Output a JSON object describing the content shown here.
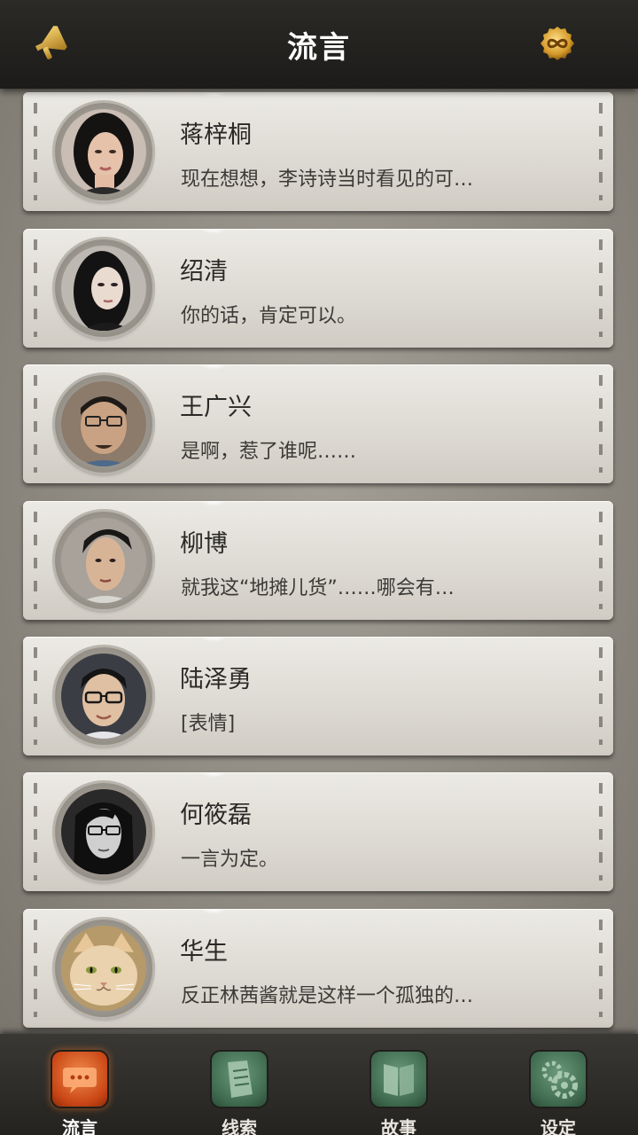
{
  "header": {
    "title": "流言",
    "left_icon": "megaphone-icon",
    "right_icon": "infinity-coin-icon",
    "accent_color": "#d9a531"
  },
  "messages": [
    {
      "name": "蒋梓桐",
      "preview": "现在想想，李诗诗当时看见的可…",
      "avatar": "woman-portrait-avatar"
    },
    {
      "name": "绍清",
      "preview": "你的话，肯定可以。",
      "avatar": "woman-portrait-avatar"
    },
    {
      "name": "王广兴",
      "preview": "是啊，惹了谁呢……",
      "avatar": "man-glasses-portrait-avatar"
    },
    {
      "name": "柳博",
      "preview": "就我这“地摊儿货”……哪会有…",
      "avatar": "man-portrait-avatar"
    },
    {
      "name": "陆泽勇",
      "preview": "[表情]",
      "avatar": "man-glasses-portrait-avatar"
    },
    {
      "name": "何筱磊",
      "preview": "一言为定。",
      "avatar": "man-glasses-portrait-avatar"
    },
    {
      "name": "华生",
      "preview": "反正林茜酱就是这样一个孤独的…",
      "avatar": "cat-portrait-avatar"
    }
  ],
  "tabs": [
    {
      "label": "流言",
      "icon": "chat-bubble-icon",
      "active": true
    },
    {
      "label": "线索",
      "icon": "note-paper-icon",
      "active": false
    },
    {
      "label": "故事",
      "icon": "book-icon",
      "active": false
    },
    {
      "label": "设定",
      "icon": "gear-icon",
      "active": false
    }
  ],
  "colors": {
    "active_tab": "#d9561c",
    "inactive_tab": "#4e7a5c"
  }
}
